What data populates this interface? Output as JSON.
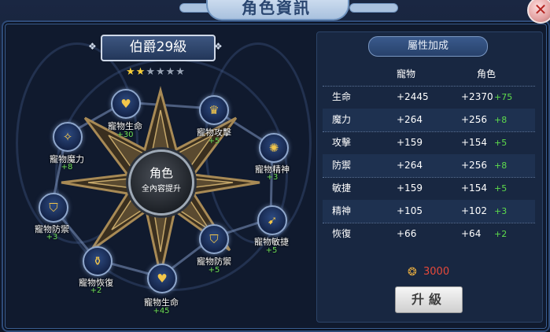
{
  "window": {
    "title": "角色資訊",
    "close_icon": "✕"
  },
  "rank": {
    "label": "伯爵29級",
    "stars_on": "★★",
    "stars_off": "★★★★"
  },
  "center": {
    "title": "角色",
    "subtitle": "全內容提升"
  },
  "nodes": [
    {
      "label": "寵物生命",
      "bonus": "+30",
      "icon": "heart-icon"
    },
    {
      "label": "寵物攻擊",
      "bonus": "+5",
      "icon": "crown-icon"
    },
    {
      "label": "寵物魔力",
      "bonus": "+8",
      "icon": "magic-icon"
    },
    {
      "label": "寵物精神",
      "bonus": "+3",
      "icon": "spirit-icon"
    },
    {
      "label": "寵物防禦",
      "bonus": "+3",
      "icon": "shield-icon"
    },
    {
      "label": "寵物敏捷",
      "bonus": "+5",
      "icon": "runner-icon"
    },
    {
      "label": "寵物恢復",
      "bonus": "+2",
      "icon": "potion-icon"
    },
    {
      "label": "寵物防禦",
      "bonus": "+5",
      "icon": "shield-icon"
    },
    {
      "label": "寵物生命",
      "bonus": "+45",
      "icon": "heart-icon"
    }
  ],
  "attributes": {
    "header": "屬性加成",
    "col_pet": "寵物",
    "col_char": "角色",
    "rows": [
      {
        "name": "生命",
        "pet": "+2445",
        "char": "+2370",
        "plus": "+75"
      },
      {
        "name": "魔力",
        "pet": "+264",
        "char": "+256",
        "plus": "+8"
      },
      {
        "name": "攻擊",
        "pet": "+159",
        "char": "+154",
        "plus": "+5"
      },
      {
        "name": "防禦",
        "pet": "+264",
        "char": "+256",
        "plus": "+8"
      },
      {
        "name": "敏捷",
        "pet": "+159",
        "char": "+154",
        "plus": "+5"
      },
      {
        "name": "精神",
        "pet": "+105",
        "char": "+102",
        "plus": "+3"
      },
      {
        "name": "恢復",
        "pet": "+66",
        "char": "+64",
        "plus": "+2"
      }
    ]
  },
  "cost": {
    "value": "3000",
    "icon": "coin-bag-icon"
  },
  "upgrade_button": {
    "label": "升級"
  },
  "colors": {
    "bonus_green": "#5edc4c",
    "cost_red": "#e8493a",
    "star_gold": "#f7cf3a"
  }
}
